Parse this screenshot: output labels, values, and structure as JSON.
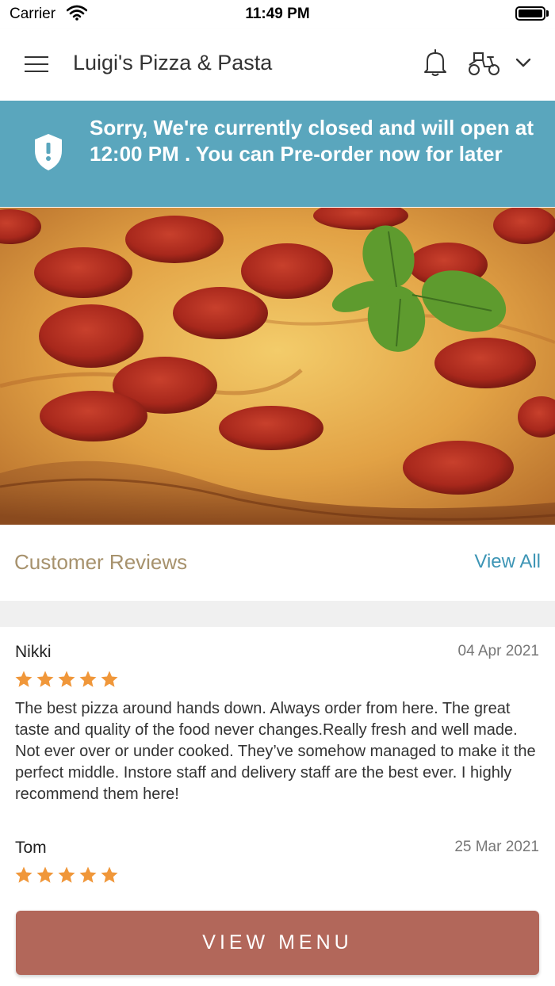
{
  "status_bar": {
    "carrier": "Carrier",
    "time": "11:49 PM",
    "battery_level": 1.0
  },
  "header": {
    "title": "Luigi's Pizza & Pasta",
    "menu_icon": "hamburger-menu-icon",
    "bell_icon": "bell-icon",
    "delivery_icon": "scooter-icon",
    "dropdown_icon": "chevron-down-icon"
  },
  "banner": {
    "icon": "shield-alert-icon",
    "message": "Sorry, We're currently closed and will open at 12:00 PM . You can Pre-order now for later"
  },
  "hero": {
    "subject": "pepperoni pizza with basil"
  },
  "reviews": {
    "title": "Customer Reviews",
    "view_all": "View All",
    "items": [
      {
        "name": "Nikki",
        "date": "04 Apr 2021",
        "rating": 5,
        "text": "The best pizza around hands down. Always order from here. The great taste and quality of the food never changes.Really fresh and well made. Not ever over or under cooked. They’ve somehow managed to make it the perfect middle. Instore staff and delivery staff are the best ever. I highly recommend them here!"
      },
      {
        "name": "Tom",
        "date": "25 Mar 2021",
        "rating": 5,
        "text": ""
      }
    ]
  },
  "footer": {
    "button_label": "VIEW MENU"
  },
  "colors": {
    "banner": "#5aa6bd",
    "button": "#b2675a",
    "star": "#f0973a",
    "reviews_title": "#a7926d",
    "link": "#3d95b5"
  }
}
